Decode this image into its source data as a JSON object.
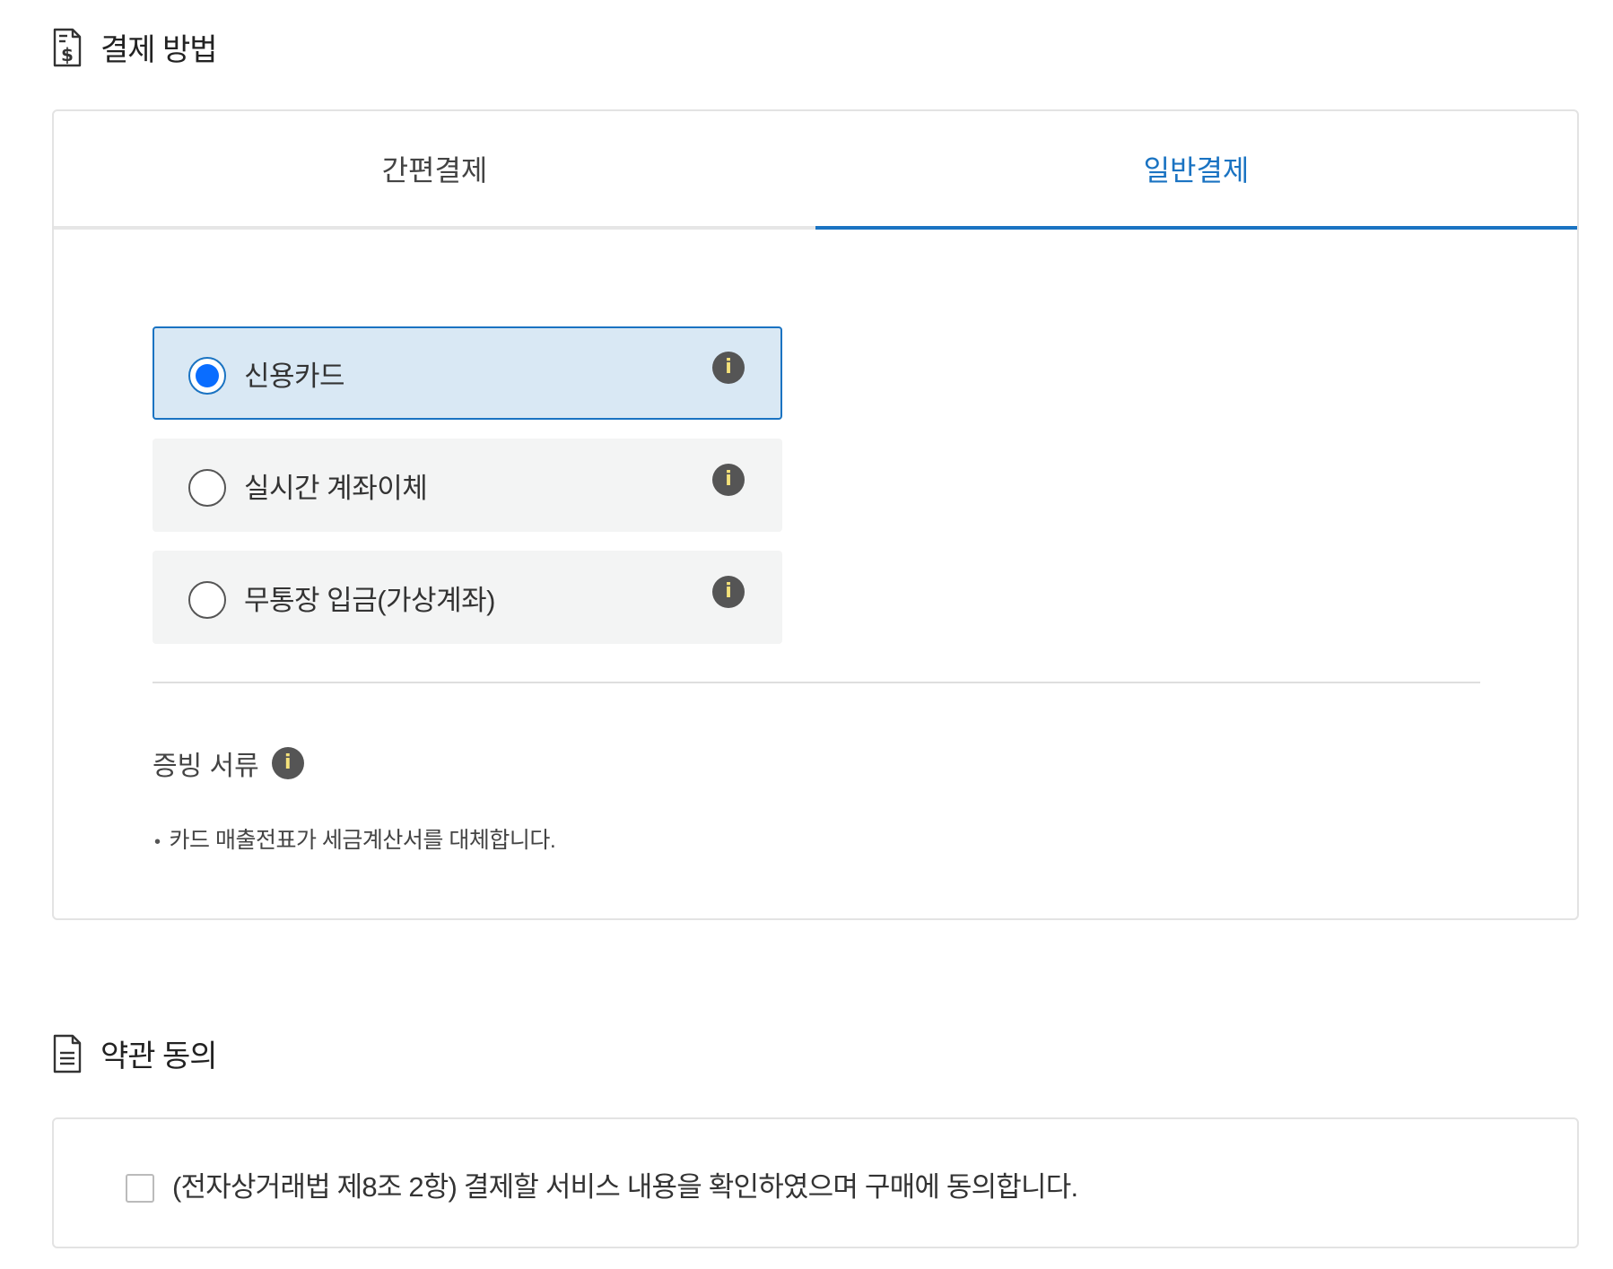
{
  "payment": {
    "title": "결제 방법",
    "tabs": [
      {
        "label": "간편결제",
        "active": false
      },
      {
        "label": "일반결제",
        "active": true
      }
    ],
    "options": [
      {
        "label": "신용카드",
        "selected": true
      },
      {
        "label": "실시간 계좌이체",
        "selected": false
      },
      {
        "label": "무통장 입금(가상계좌)",
        "selected": false
      }
    ],
    "info_glyph": "i",
    "documents": {
      "title": "증빙 서류",
      "bullet": "•",
      "note": "카드 매출전표가 세금계산서를 대체합니다."
    }
  },
  "terms": {
    "title": "약관 동의",
    "agreement_text": "(전자상거래법 제8조 2항) 결제할 서비스 내용을 확인하였으며 구매에 동의합니다.",
    "checked": false
  },
  "colors": {
    "accent": "#1a73c2",
    "radio_fill": "#0a6dff",
    "selected_bg": "#d9e8f4",
    "option_bg": "#f3f4f4",
    "info_bg": "#555555",
    "info_glyph": "#f5e27a"
  },
  "icons": {
    "payment_section": "invoice-dollar-icon",
    "terms_section": "document-icon",
    "info": "info-icon"
  }
}
